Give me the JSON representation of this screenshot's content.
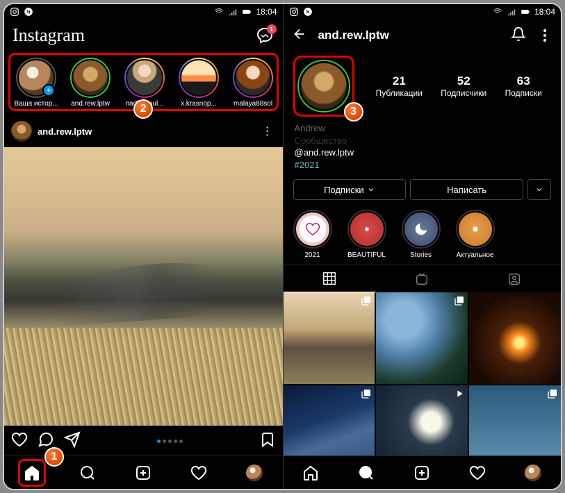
{
  "statusbar": {
    "time": "18:04"
  },
  "callouts": {
    "c1": "1",
    "c2": "2",
    "c3": "3"
  },
  "feed": {
    "logo": "Instagram",
    "msg_badge": "1",
    "stories": [
      {
        "label": "Ваша истор..."
      },
      {
        "label": "and.rew.lptw"
      },
      {
        "label": "nadianraul..."
      },
      {
        "label": "x.krasnop..."
      },
      {
        "label": "malaya88sol"
      }
    ],
    "post_user": "and.rew.lptw"
  },
  "profile": {
    "username": "and.rew.lptw",
    "stats": {
      "posts_n": "21",
      "posts_l": "Публикации",
      "followers_n": "52",
      "followers_l": "Подписчики",
      "following_n": "63",
      "following_l": "Подписки"
    },
    "bio_name": "Andrew",
    "bio_cat": "Сообщество",
    "bio_handle": "@and.rew.lptw",
    "bio_tag": "#2021",
    "btn_following": "Подписки",
    "btn_message": "Написать",
    "highlights": [
      {
        "label": "2021"
      },
      {
        "label": "BEAUTIFUL"
      },
      {
        "label": "Stories"
      },
      {
        "label": "Актуальное"
      }
    ]
  }
}
